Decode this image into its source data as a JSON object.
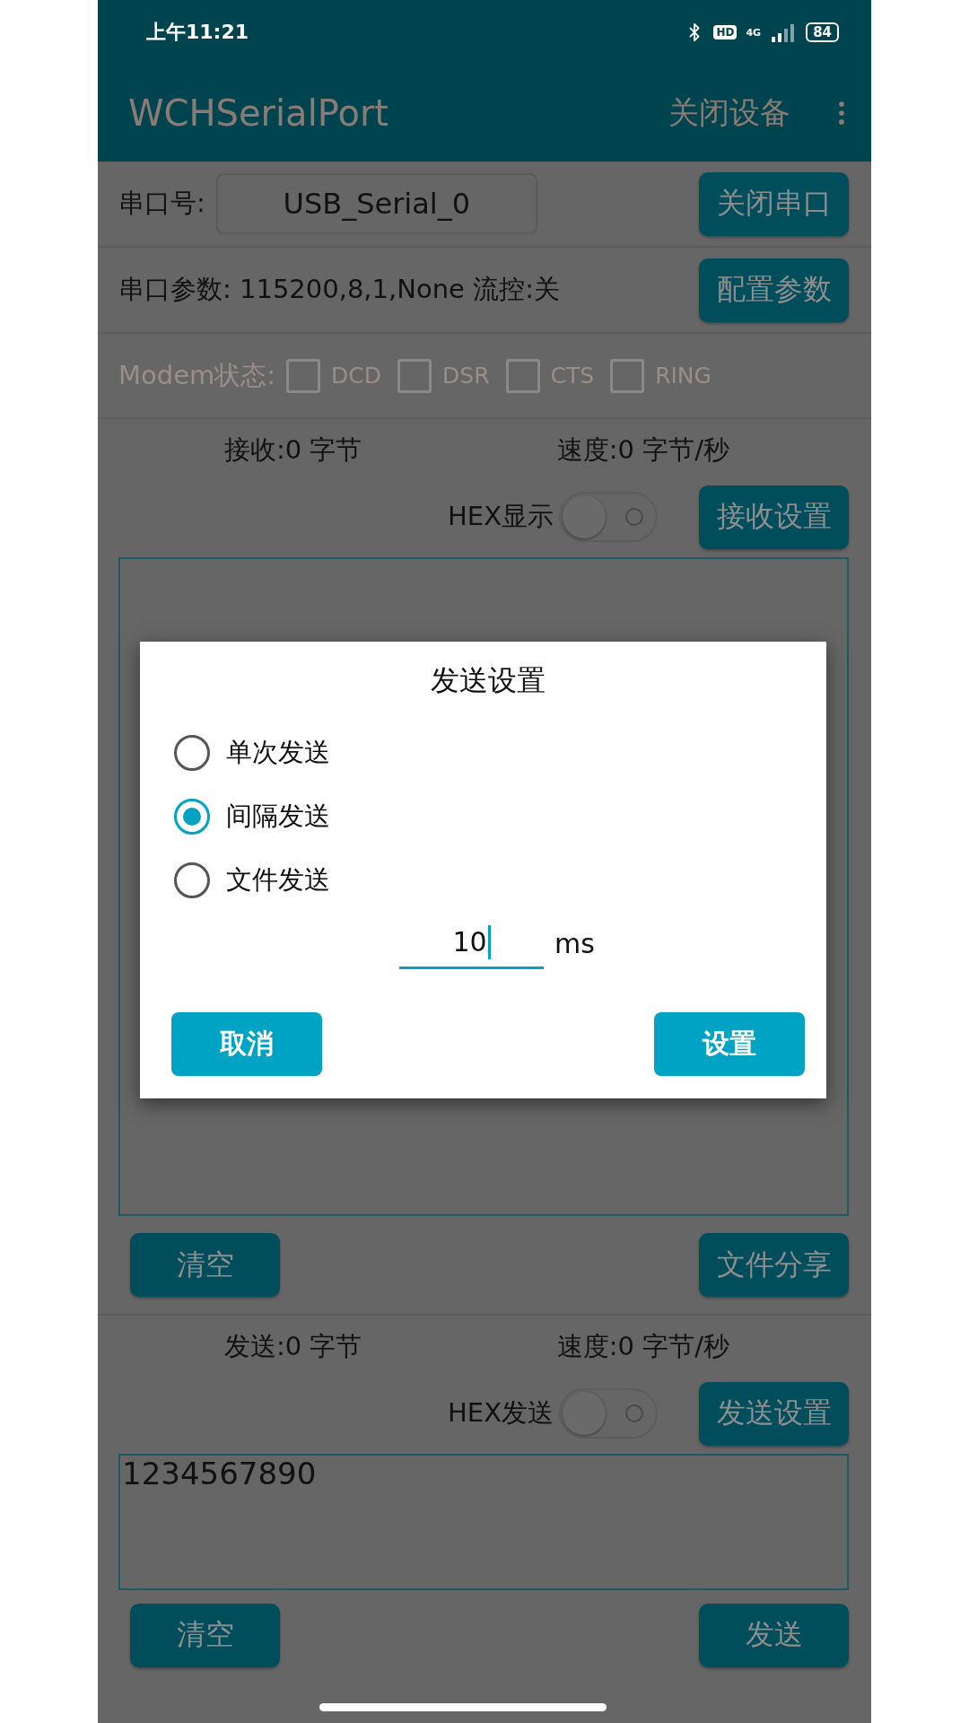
{
  "status_bar": {
    "time": "上午11:21",
    "hd": "HD",
    "network": "4G",
    "battery": "84"
  },
  "app_bar": {
    "title": "WCHSerialPort",
    "action": "关闭设备"
  },
  "serial_row": {
    "label": "串口号:",
    "port": "USB_Serial_0",
    "button": "关闭串口"
  },
  "params_row": {
    "text": "串口参数: 115200,8,1,None 流控:关",
    "button": "配置参数"
  },
  "modem": {
    "label": "Modem状态:",
    "disabled": true,
    "signals": [
      {
        "name": "DCD",
        "checked": false
      },
      {
        "name": "DSR",
        "checked": false
      },
      {
        "name": "CTS",
        "checked": false
      },
      {
        "name": "RING",
        "checked": false
      }
    ]
  },
  "receive": {
    "count": "接收:0 字节",
    "speed": "速度:0 字节/秒",
    "hex": {
      "label": "HEX显示",
      "on": false
    },
    "settings_button": "接收设置",
    "clear_button": "清空",
    "share_button": "文件分享"
  },
  "send": {
    "count": "发送:0 字节",
    "speed": "速度:0 字节/秒",
    "hex": {
      "label": "HEX发送",
      "on": false
    },
    "settings_button": "发送设置",
    "input": "1234567890",
    "clear_button": "清空",
    "send_button": "发送"
  },
  "dialog": {
    "title": "发送设置",
    "options": [
      {
        "label": "单次发送",
        "selected": false
      },
      {
        "label": "间隔发送",
        "selected": true
      },
      {
        "label": "文件发送",
        "selected": false
      }
    ],
    "interval": {
      "value": "10",
      "unit": "ms"
    },
    "cancel": "取消",
    "confirm": "设置"
  }
}
